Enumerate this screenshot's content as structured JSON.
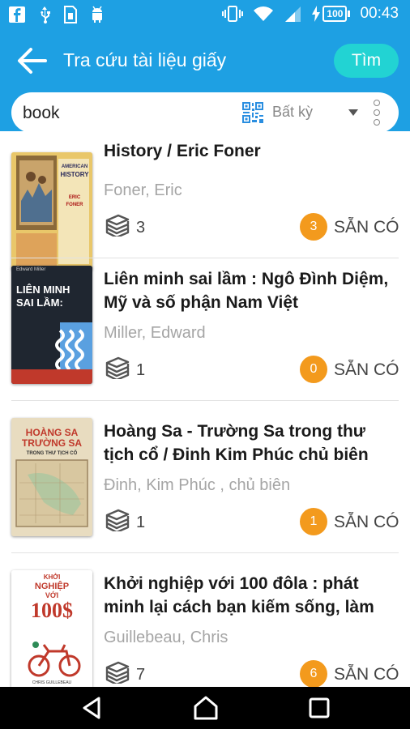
{
  "status_bar": {
    "time": "00:43",
    "battery": "100",
    "left_icons": [
      "facebook-icon",
      "usb-icon",
      "sim-icon",
      "android-icon"
    ],
    "right_icons": [
      "vibrate-icon",
      "wifi-icon",
      "signal-icon",
      "charging-icon"
    ]
  },
  "app_bar": {
    "title": "Tra cứu tài liệu giấy",
    "find_label": "Tìm",
    "accent_color": "#1ea0e3",
    "button_color": "#22d3d3"
  },
  "search": {
    "value": "book",
    "scope": "Bất kỳ"
  },
  "results": [
    {
      "title": "History / Eric Foner",
      "author": "Foner, Eric",
      "copies": "3",
      "available": "3",
      "status": "SẴN CÓ",
      "cover_lines": [
        "AMERICAN",
        "HISTORY",
        "ERIC",
        "FONER"
      ]
    },
    {
      "title": "Liên minh sai lầm : Ngô Đình Diệm, Mỹ và số phận Nam Việt",
      "author": "Miller, Edward",
      "copies": "1",
      "available": "0",
      "status": "SẴN CÓ",
      "cover_lines": [
        "Edward Miller",
        "LIÊN MINH",
        "SAI LẦM:"
      ]
    },
    {
      "title": "Hoàng Sa - Trường Sa trong thư tịch cổ / Đinh  Kim Phúc chủ biên",
      "author": "Đinh, Kim Phúc ,  chủ biên",
      "copies": "1",
      "available": "1",
      "status": "SẴN CÓ",
      "cover_lines": [
        "HOÀNG SA",
        "TRƯỜNG SA",
        "TRONG THƯ TỊCH CỔ"
      ]
    },
    {
      "title": "Khởi nghiệp với 100 đôla : phát minh lại cách bạn kiếm sống, làm",
      "author": "Guillebeau, Chris",
      "copies": "7",
      "available": "6",
      "status": "SẴN CÓ",
      "cover_lines": [
        "KHỞI",
        "NGHIỆP",
        "VỚI",
        "100$",
        "CHRIS GUILLEBEAU"
      ]
    }
  ],
  "nav": [
    "back-nav-icon",
    "home-nav-icon",
    "recents-nav-icon"
  ]
}
